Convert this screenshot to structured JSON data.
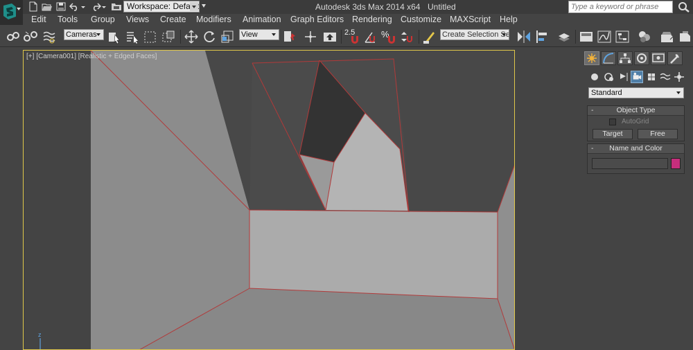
{
  "colors": {
    "object_color": "#c72e7c",
    "viewport_border": "#e1c84a",
    "edge": "#b23a3a"
  },
  "titlebar": {
    "workspace_label": "Workspace: Default",
    "app_title": "Autodesk 3ds Max  2014 x64",
    "document_title": "Untitled",
    "search_placeholder": "Type a keyword or phrase",
    "quick_access_icons": [
      "new-file-icon",
      "open-file-icon",
      "save-icon",
      "undo-icon",
      "undo-dropdown-icon",
      "redo-icon",
      "redo-dropdown-icon",
      "project-folder-icon"
    ]
  },
  "menu": [
    {
      "label": "Edit",
      "icon": ""
    },
    {
      "label": "Tools",
      "icon": ""
    },
    {
      "label": "Group",
      "icon": ""
    },
    {
      "label": "Views",
      "icon": ""
    },
    {
      "label": "Create",
      "icon": ""
    },
    {
      "label": "Modifiers",
      "icon": ""
    },
    {
      "label": "Animation",
      "icon": ""
    },
    {
      "label": "Graph Editors",
      "icon": ""
    },
    {
      "label": "Rendering",
      "icon": ""
    },
    {
      "label": "Customize",
      "icon": ""
    },
    {
      "label": "MAXScript",
      "icon": ""
    },
    {
      "label": "Help",
      "icon": ""
    }
  ],
  "toolbar": {
    "selection_filter": "Cameras",
    "reference_coordinate": "View",
    "named_selection_placeholder": "Create Selection Se",
    "snap_label": "2.5",
    "percent_snap_label": "%",
    "tools": [
      "link-icon",
      "unlink-icon",
      "bind-space-warp-icon",
      "select-object-icon",
      "select-by-name-icon",
      "rectangular-selection-icon",
      "window-crossing-icon",
      "select-move-icon",
      "select-rotate-icon",
      "select-scale-icon",
      "pivot-center-icon",
      "select-manipulate-icon",
      "keyboard-shortcut-icon",
      "snaps-toggle-icon",
      "angle-snap-icon",
      "percent-snap-icon",
      "spinner-snap-icon",
      "edit-named-selection-icon",
      "mirror-icon",
      "align-icon",
      "layer-explorer-icon",
      "toggle-ribbon-icon",
      "curve-editor-icon",
      "schematic-view-icon",
      "material-editor-icon",
      "render-setup-icon",
      "rendered-frame-icon",
      "render-icon"
    ]
  },
  "viewport": {
    "labels": [
      "[+]",
      "[Camera001]",
      "[Realistic + Edged Faces]"
    ],
    "axis_label": "z"
  },
  "command_panel": {
    "tabs": [
      "create-tab-icon",
      "modify-tab-icon",
      "hierarchy-tab-icon",
      "motion-tab-icon",
      "display-tab-icon",
      "utilities-tab-icon"
    ],
    "subtabs": [
      "geometry-icon",
      "shapes-icon",
      "lights-icon",
      "cameras-icon",
      "helpers-icon",
      "space-warps-icon",
      "systems-icon"
    ],
    "category": "Standard",
    "object_type": {
      "title": "Object Type",
      "toggle": "-",
      "autogrid_label": "AutoGrid",
      "buttons": [
        "Target",
        "Free"
      ]
    },
    "name_and_color": {
      "title": "Name and Color",
      "toggle": "-",
      "name_value": ""
    }
  }
}
